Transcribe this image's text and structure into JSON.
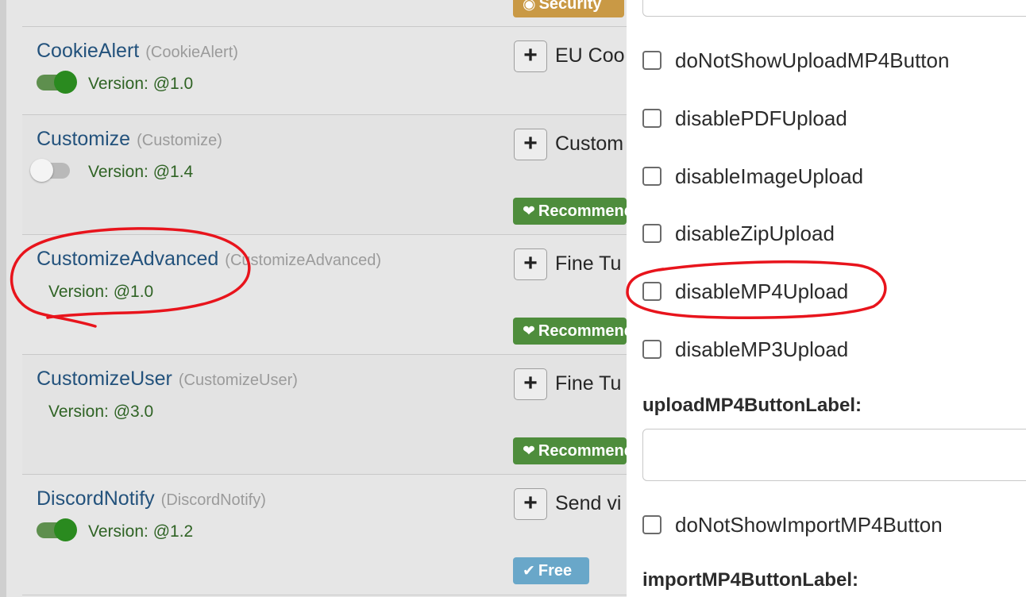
{
  "colors": {
    "link": "#23527c",
    "version": "#2f6324",
    "toggle_on": "#2a8a1f",
    "badge_recommended": "#4e8d3c",
    "badge_free": "#69a7c9",
    "badge_security": "#c99945",
    "annotation": "#e8141c"
  },
  "plugins": [
    {
      "name": "",
      "id": "",
      "version": "",
      "description": "",
      "badge": "Security",
      "badge_icon": "user-shield-icon"
    },
    {
      "name": "CookieAlert",
      "id": "(CookieAlert)",
      "version": "Version: @1.0",
      "enabled": true,
      "description": "EU Coo"
    },
    {
      "name": "Customize",
      "id": "(Customize)",
      "version": "Version: @1.4",
      "enabled": false,
      "description": "Custom",
      "badge": "Recommended",
      "badge_icon": "heart-icon"
    },
    {
      "name": "CustomizeAdvanced",
      "id": "(CustomizeAdvanced)",
      "version": "Version: @1.0",
      "description": "Fine Tu",
      "badge": "Recommended",
      "badge_icon": "heart-icon"
    },
    {
      "name": "CustomizeUser",
      "id": "(CustomizeUser)",
      "version": "Version: @3.0",
      "description": "Fine Tu",
      "badge": "Recommended",
      "badge_icon": "heart-icon"
    },
    {
      "name": "DiscordNotify",
      "id": "(DiscordNotify)",
      "version": "Version: @1.2",
      "enabled": true,
      "description": "Send vi",
      "badge": "Free",
      "badge_icon": "check-icon"
    }
  ],
  "panel": {
    "top_input_value": "",
    "options": [
      {
        "label": "doNotShowUploadMP4Button",
        "checked": false
      },
      {
        "label": "disablePDFUpload",
        "checked": false
      },
      {
        "label": "disableImageUpload",
        "checked": false
      },
      {
        "label": "disableZipUpload",
        "checked": false
      },
      {
        "label": "disableMP4Upload",
        "checked": false
      },
      {
        "label": "disableMP3Upload",
        "checked": false
      }
    ],
    "upload_label_field": {
      "label": "uploadMP4ButtonLabel:",
      "value": ""
    },
    "import_option": {
      "label": "doNotShowImportMP4Button",
      "checked": false
    },
    "import_label_field": {
      "label": "importMP4ButtonLabel:"
    }
  }
}
